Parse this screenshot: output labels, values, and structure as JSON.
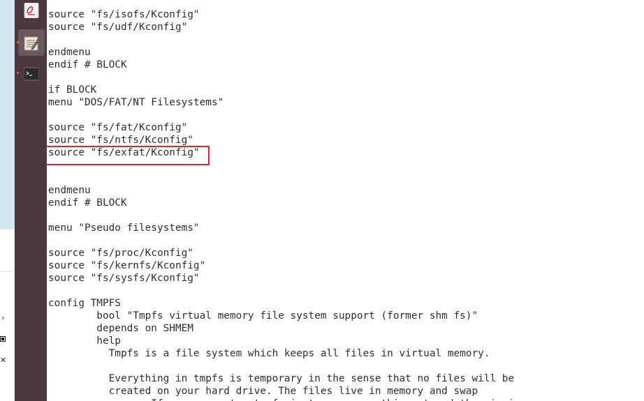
{
  "left_strip": {
    "icons": [
      {
        "name": "chevron-right-icon",
        "glyph": "›"
      },
      {
        "name": "battery-icon",
        "glyph": "▮"
      },
      {
        "name": "close-icon",
        "glyph": "✕"
      }
    ]
  },
  "launcher": {
    "items": [
      {
        "name": "launcher-item-pdf-viewer",
        "icon": "pdf-document-icon",
        "active": false
      },
      {
        "name": "launcher-item-text-editor",
        "icon": "text-editor-icon",
        "active": true
      },
      {
        "name": "launcher-item-terminal",
        "icon": "terminal-icon",
        "active": false
      }
    ],
    "colors": {
      "background": "#4a3740",
      "active": "#6a5860",
      "indicator": "#f06b2e"
    }
  },
  "editor": {
    "lines": [
      "source \"fs/isofs/Kconfig\"",
      "source \"fs/udf/Kconfig\"",
      "",
      "endmenu",
      "endif # BLOCK",
      "",
      "if BLOCK",
      "menu \"DOS/FAT/NT Filesystems\"",
      "",
      "source \"fs/fat/Kconfig\"",
      "source \"fs/ntfs/Kconfig\"",
      "source \"fs/exfat/Kconfig\"",
      "",
      "",
      "endmenu",
      "endif # BLOCK",
      "",
      "menu \"Pseudo filesystems\"",
      "",
      "source \"fs/proc/Kconfig\"",
      "source \"fs/kernfs/Kconfig\"",
      "source \"fs/sysfs/Kconfig\"",
      "",
      "config TMPFS",
      "        bool \"Tmpfs virtual memory file system support (former shm fs)\"",
      "        depends on SHMEM",
      "        help",
      "          Tmpfs is a file system which keeps all files in virtual memory.",
      "",
      "          Everything in tmpfs is temporary in the sense that no files will be",
      "          created on your hard drive. The files live in memory and swap",
      "          space. If you unmount a tmpfs instance, everything stored therein is"
    ],
    "highlighted_line": "source \"fs/exfat/Kconfig\"",
    "highlight_color": "#e0262a"
  }
}
